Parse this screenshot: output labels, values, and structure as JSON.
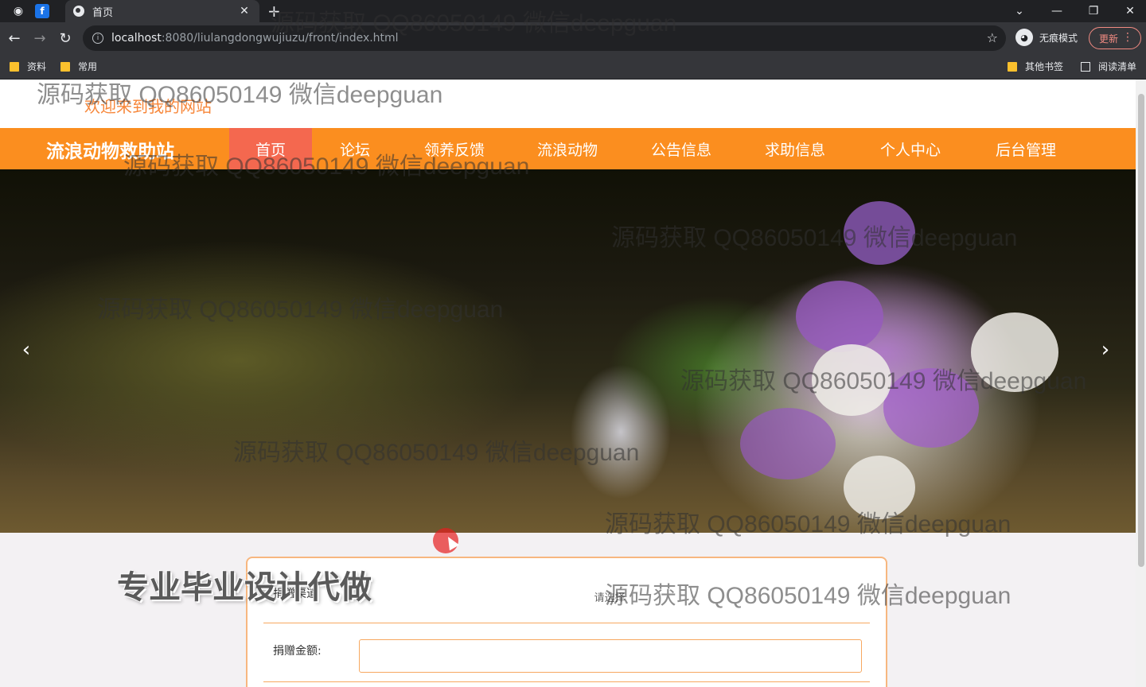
{
  "browser": {
    "tab_title": "首页",
    "url_host": "localhost",
    "url_rest": ":8080/liulangdongwujiuzu/front/index.html",
    "incognito_label": "无痕模式",
    "update_label": "更新",
    "bookmarks": [
      "资料",
      "常用"
    ],
    "bookmarks_right": [
      "其他书签",
      "阅读清单"
    ]
  },
  "header": {
    "welcome": "欢迎来到我的网站"
  },
  "nav": {
    "site_name": "流浪动物救助站",
    "items": [
      "首页",
      "论坛",
      "领养反馈",
      "流浪动物",
      "公告信息",
      "求助信息",
      "个人中心",
      "后台管理"
    ],
    "active_index": 0
  },
  "banner": {
    "slide_count": 3,
    "active_slide": 0,
    "colors": {
      "accent": "#fb8e1f"
    }
  },
  "form": {
    "row1_label": "捐赠渠道",
    "row1_placeholder": "请选择",
    "row2_label": "捐赠金额:",
    "row2_value": ""
  },
  "promo_text": "专业毕业设计代做",
  "watermarks": [
    "源码获取 QQ86050149 微信deepguan"
  ],
  "colors": {
    "nav_bg": "#fb8e1f",
    "nav_active": "#f4684f",
    "welcome_text": "#f7873a"
  }
}
